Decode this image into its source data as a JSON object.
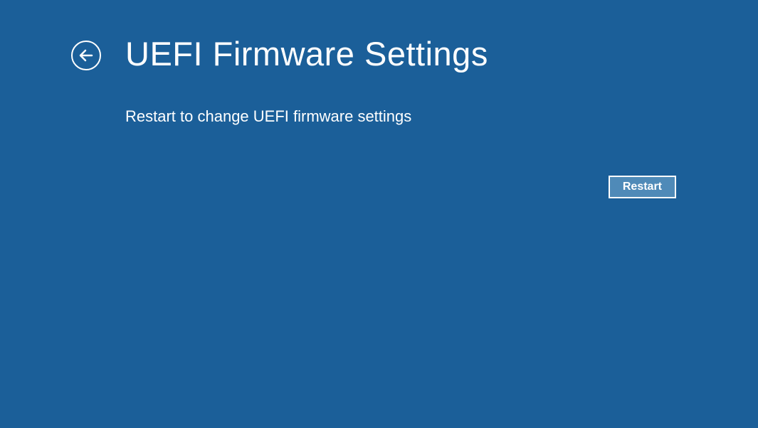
{
  "header": {
    "title": "UEFI Firmware Settings"
  },
  "main": {
    "subtitle": "Restart to change UEFI firmware settings"
  },
  "actions": {
    "restart_label": "Restart"
  }
}
